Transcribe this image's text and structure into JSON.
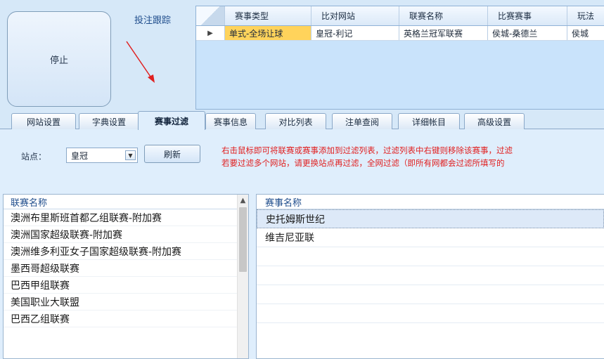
{
  "controls": {
    "stop_label": "停止",
    "follow_label": "投注跟踪"
  },
  "top_grid": {
    "columns": [
      "赛事类型",
      "比对网站",
      "联赛名称",
      "比赛赛事",
      "玩法"
    ],
    "rows": [
      {
        "indicator": "▶",
        "cells": [
          "单式-全场让球",
          "皇冠-利记",
          "英格兰冠军联赛",
          "侯城-桑德兰",
          "侯城"
        ]
      }
    ]
  },
  "tabs": [
    "网站设置",
    "字典设置",
    "赛事过滤",
    "赛事信息",
    "对比列表",
    "注单查阅",
    "详细帐目",
    "高级设置"
  ],
  "active_tab": "赛事过滤",
  "filter": {
    "site_label": "站点：",
    "site_value": "皇冠",
    "refresh_label": "刷新",
    "hint_line1": "右击鼠标即可将联赛或赛事添加到过滤列表，过滤列表中右键则移除该赛事，过滤",
    "hint_line2": "若要过滤多个网站，请更换站点再过滤，全网过滤（即所有网都会过滤所填写的"
  },
  "league_list": {
    "header": "联赛名称",
    "items": [
      "澳洲布里斯班首都乙组联赛-附加赛",
      "澳洲国家超级联赛-附加赛",
      "澳洲维多利亚女子国家超级联赛-附加赛",
      "墨西哥超级联赛",
      "巴西甲组联赛",
      "美国职业大联盟",
      "巴西乙组联赛"
    ]
  },
  "match_list": {
    "header": "赛事名称",
    "items": [
      "史托姆斯世纪",
      "维吉尼亚联"
    ]
  }
}
